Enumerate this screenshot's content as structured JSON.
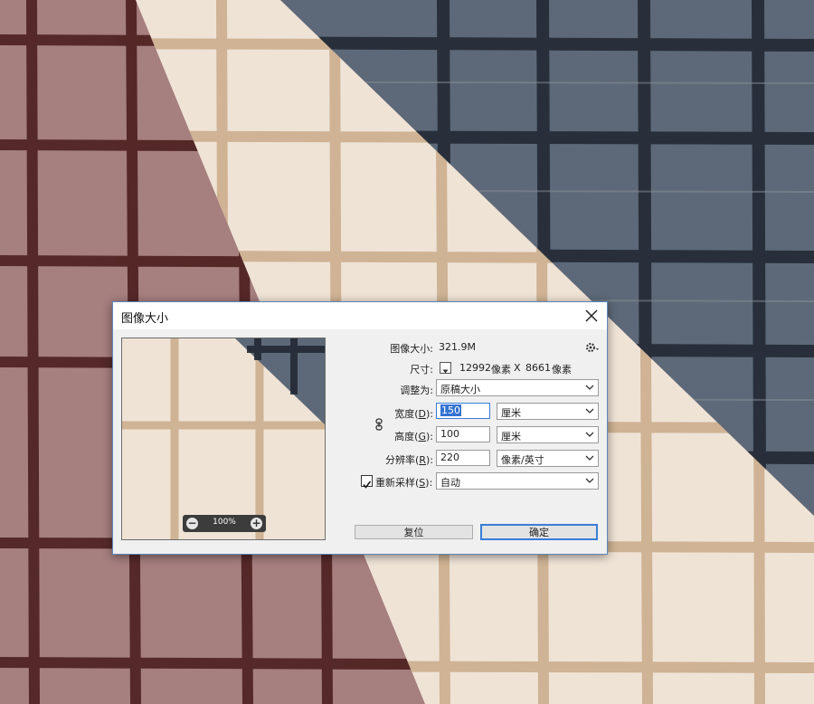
{
  "dialog": {
    "title": "图像大小",
    "close_icon": "close-icon",
    "image_size_label": "图像大小:",
    "image_size_value": "321.9M",
    "settings_icon": "gear-icon",
    "dimensions_label": "尺寸:",
    "dimensions_width": "12992",
    "dimensions_unit_1": "像素",
    "dimensions_x": "X",
    "dimensions_height": "8661",
    "dimensions_unit_2": "像素",
    "fit_to_label": "调整为:",
    "fit_to_value": "原稿大小",
    "width_label": "宽度(",
    "width_key": "D",
    "width_label_end": "):",
    "width_value": "150",
    "width_unit": "厘米",
    "height_label": "高度(",
    "height_key": "G",
    "height_label_end": "):",
    "height_value": "100",
    "height_unit": "厘米",
    "resolution_label": "分辨率(",
    "resolution_key": "R",
    "resolution_label_end": "):",
    "resolution_value": "220",
    "resolution_unit": "像素/英寸",
    "resample_label": "重新采样(",
    "resample_key": "S",
    "resample_label_end": "):",
    "resample_checked": true,
    "resample_value": "自动",
    "link_icon": "chain-link-icon",
    "preview_zoom": "100%",
    "reset_button": "复位",
    "ok_button": "确定"
  },
  "colors": {
    "plaid_rose": "#a67f7f",
    "plaid_beige": "#efe3d6",
    "plaid_slate": "#5d6978",
    "dark_stripe": "#4d2020",
    "tan_stripe": "#c9ab89",
    "navy_stripe": "#1f2631",
    "accent": "#3472d2"
  }
}
